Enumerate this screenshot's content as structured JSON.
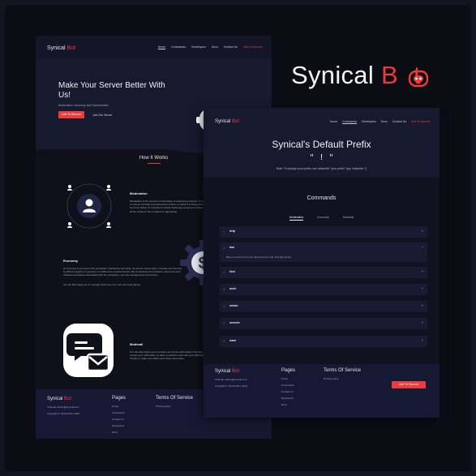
{
  "brand": {
    "name": "Synical",
    "accent": "Bot",
    "accent_color": "#ef3a3a"
  },
  "back_page": {
    "nav": [
      "Home",
      "Commands",
      "Developers",
      "Docs",
      "Contact Us"
    ],
    "nav_cta": "Add to Discord",
    "hero": {
      "title": "Make Your Server Better With Us!",
      "subtitle": "Moderation, economy and Gamemodes",
      "primary_button": "Add To Discord",
      "secondary_button": "Join Our Server"
    },
    "how_title": "How It Works",
    "sections": [
      {
        "title": "Moderation",
        "text": "Moderation is the process of eliminating or lessening extremes. It is used to ensure normality throughout the medium on which it is being conducted. Common duties of moderators include: Ensuring everyone is unique. Keep all the content in the meadow in appropriate."
      },
      {
        "title": "Economy",
        "text": "An economy is an area of the production, distribution and trade, as well as consumption of goods and services by different agents. In general, it is defined as a social domain that emphasizes the practices, discourses and material expressions associated with the production, use and management of resources."
      },
      {
        "title": "Modmail",
        "text": "Our site also helps you to contact your server staff easily in the form of Modmail. Users can contact your staff easily. It makes yourself to work with your staff well and resolve their problems. It helps to make your staff's work faster and easier."
      }
    ],
    "economy_extra": "Our bot also helps you to manage which use your own cash and games",
    "footer": {
      "email": "Email: admin@synical.com",
      "copyright": "Copyright © Synical Bot, 2022",
      "pages_title": "Pages",
      "pages": [
        "Home",
        "Commands",
        "Contact Us",
        "Developers",
        "Docs"
      ],
      "terms_title": "Terms Of Service",
      "privacy": "Privacy policy",
      "button": "Add To Discord"
    }
  },
  "front_page": {
    "nav": [
      "Home",
      "Commands",
      "Developers",
      "Docs",
      "Contact Us"
    ],
    "nav_cta": "Add to Discord",
    "title": "Synical's Default Prefix",
    "prefix": "\" ! \"",
    "note": "Note: To change your prefix, use /setprefix \"your prefix\" (eg: !setprefix ?)",
    "commands_title": "Commands",
    "tabs": [
      "Moderation",
      "Economy",
      "Modmail"
    ],
    "active_tab": "Moderation",
    "commands": [
      {
        "name": "help",
        "open": false,
        "indicator": "+"
      },
      {
        "name": "ban",
        "open": true,
        "indicator": "−",
        "desc": "Ban a member from your discord server. Eg: !ban @member"
      },
      {
        "name": "kick",
        "open": false,
        "indicator": "+"
      },
      {
        "name": "mute",
        "open": false,
        "indicator": "+"
      },
      {
        "name": "unban",
        "open": false,
        "indicator": "+"
      },
      {
        "name": "unmute",
        "open": false,
        "indicator": "+"
      },
      {
        "name": "warn",
        "open": false,
        "indicator": "+"
      }
    ],
    "footer": {
      "email": "Email: admin@synical.com",
      "copyright": "Copyright © Synical Bot, 2022",
      "pages_title": "Pages",
      "pages": [
        "Home",
        "Commands",
        "Contact Us",
        "Developers",
        "Docs"
      ],
      "terms_title": "Terms Of Service",
      "privacy": "Privacy policy",
      "button": "Add To Discord"
    }
  },
  "showcase_title": {
    "main": "Synical",
    "accent": "B",
    "tail": "t"
  },
  "icons": [
    "robot-icon",
    "user-icon",
    "dollar-icon",
    "chat-bubble-icon",
    "mail-icon",
    "email-icon",
    "chevron-right-icon",
    "plus-icon",
    "minus-icon"
  ]
}
